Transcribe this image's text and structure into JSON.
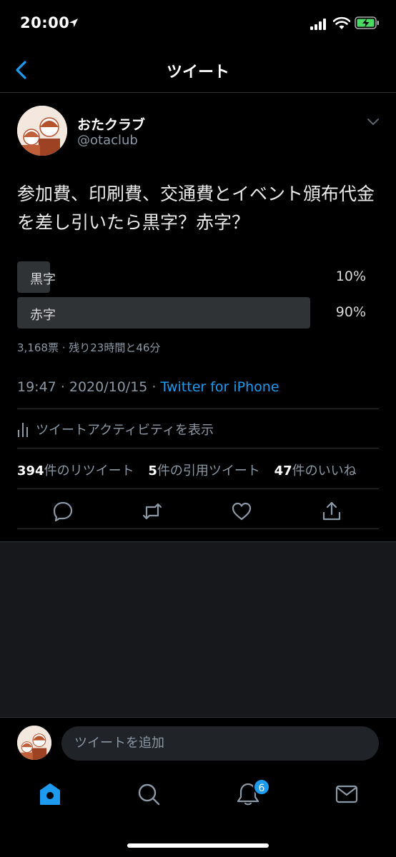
{
  "status_bar": {
    "time": "20:00"
  },
  "nav": {
    "title": "ツイート"
  },
  "tweet": {
    "display_name": "おたクラブ",
    "handle": "@otaclub",
    "text": "参加費、印刷費、交通費とイベント頒布代金を差し引いたら黒字？赤字？",
    "poll": {
      "options": [
        {
          "label": "黒字",
          "percent": "10%",
          "fraction": 0.1
        },
        {
          "label": "赤字",
          "percent": "90%",
          "fraction": 0.9
        }
      ],
      "meta": "3,168票 · 残り23時間と46分"
    },
    "timestamp": "19:47 · 2020/10/15 · ",
    "source": "Twitter for iPhone",
    "activity_label": "ツイートアクティビティを表示",
    "stats": {
      "retweets_count": "394",
      "retweets_label": "件のリツイート",
      "quotes_count": "5",
      "quotes_label": "件の引用ツイート",
      "likes_count": "47",
      "likes_label": "件のいいね"
    }
  },
  "reply": {
    "placeholder": "ツイートを追加"
  },
  "tabbar": {
    "notifications_badge": "6"
  },
  "colors": {
    "accent": "#1d9bf0",
    "background": "#000000",
    "secondary_text": "#8b98a5",
    "poll_bar": "#2f3336"
  },
  "icons": [
    "back-icon",
    "chevron-down-icon",
    "reply-icon",
    "retweet-icon",
    "like-icon",
    "share-icon",
    "home-icon",
    "search-icon",
    "notifications-icon",
    "messages-icon",
    "bar-chart-icon"
  ]
}
